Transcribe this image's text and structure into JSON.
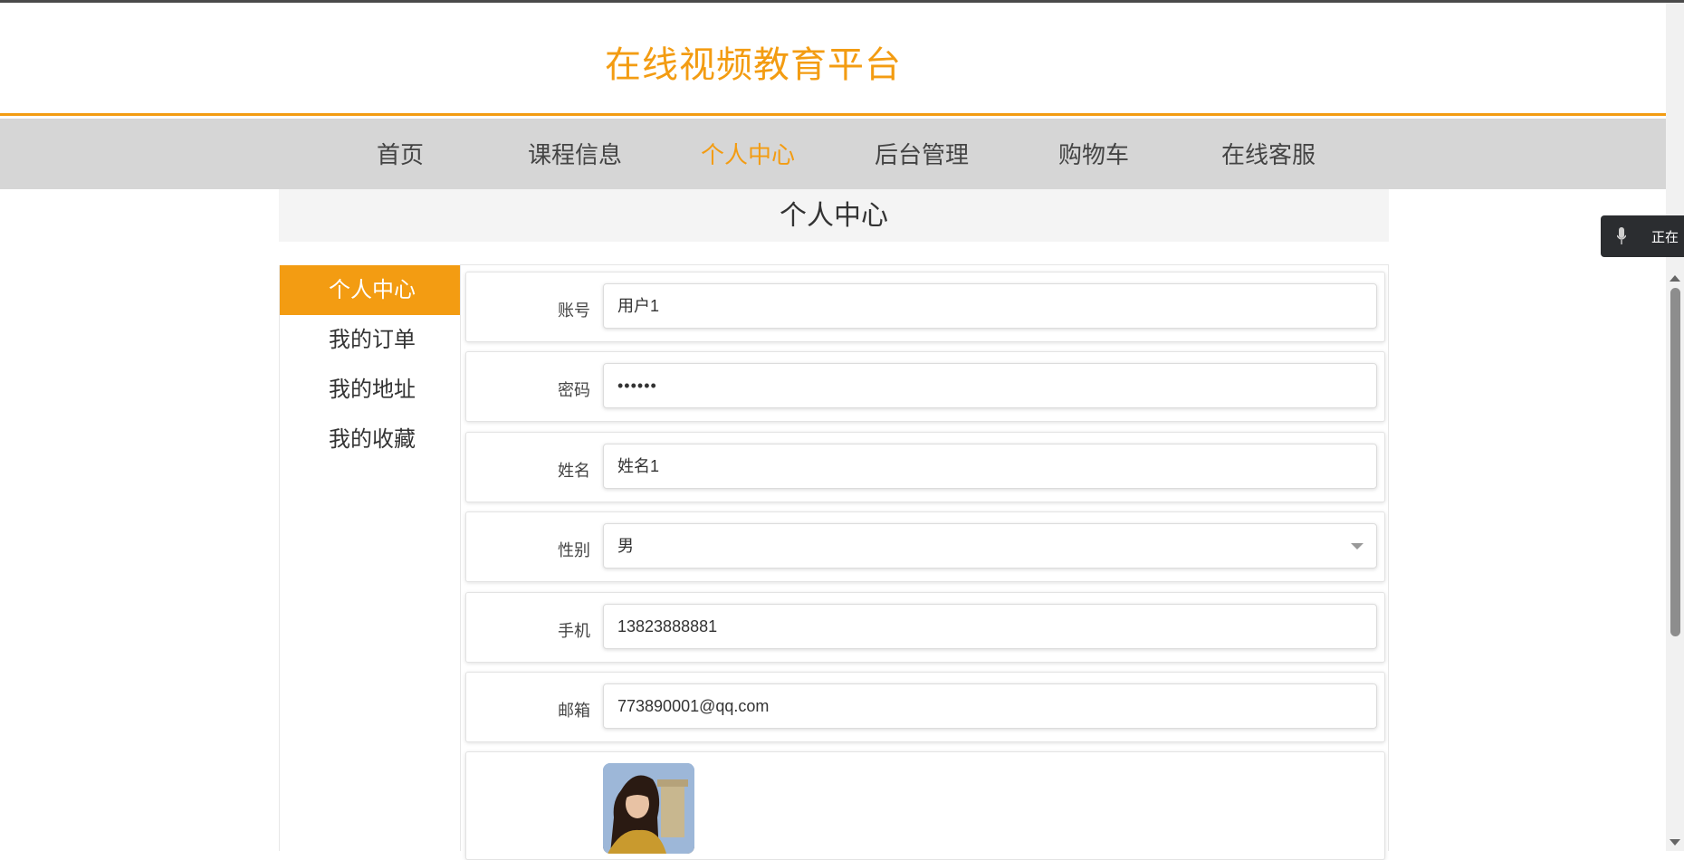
{
  "header": {
    "site_title": "在线视频教育平台"
  },
  "nav": {
    "items": [
      {
        "label": "首页"
      },
      {
        "label": "课程信息"
      },
      {
        "label": "个人中心"
      },
      {
        "label": "后台管理"
      },
      {
        "label": "购物车"
      },
      {
        "label": "在线客服"
      }
    ],
    "active": "个人中心"
  },
  "page": {
    "title": "个人中心"
  },
  "sidebar": {
    "items": [
      {
        "label": "个人中心"
      },
      {
        "label": "我的订单"
      },
      {
        "label": "我的地址"
      },
      {
        "label": "我的收藏"
      }
    ],
    "active": "个人中心"
  },
  "form": {
    "account": {
      "label": "账号",
      "value": "用户1"
    },
    "password": {
      "label": "密码",
      "value": "••••••"
    },
    "name": {
      "label": "姓名",
      "value": "姓名1"
    },
    "gender": {
      "label": "性别",
      "value": "男"
    },
    "phone": {
      "label": "手机",
      "value": "13823888881"
    },
    "email": {
      "label": "邮箱",
      "value": "773890001@qq.com"
    }
  },
  "voice_widget": {
    "text": "正在"
  },
  "colors": {
    "accent": "#f39c12",
    "nav_bg": "#d6d6d6"
  }
}
